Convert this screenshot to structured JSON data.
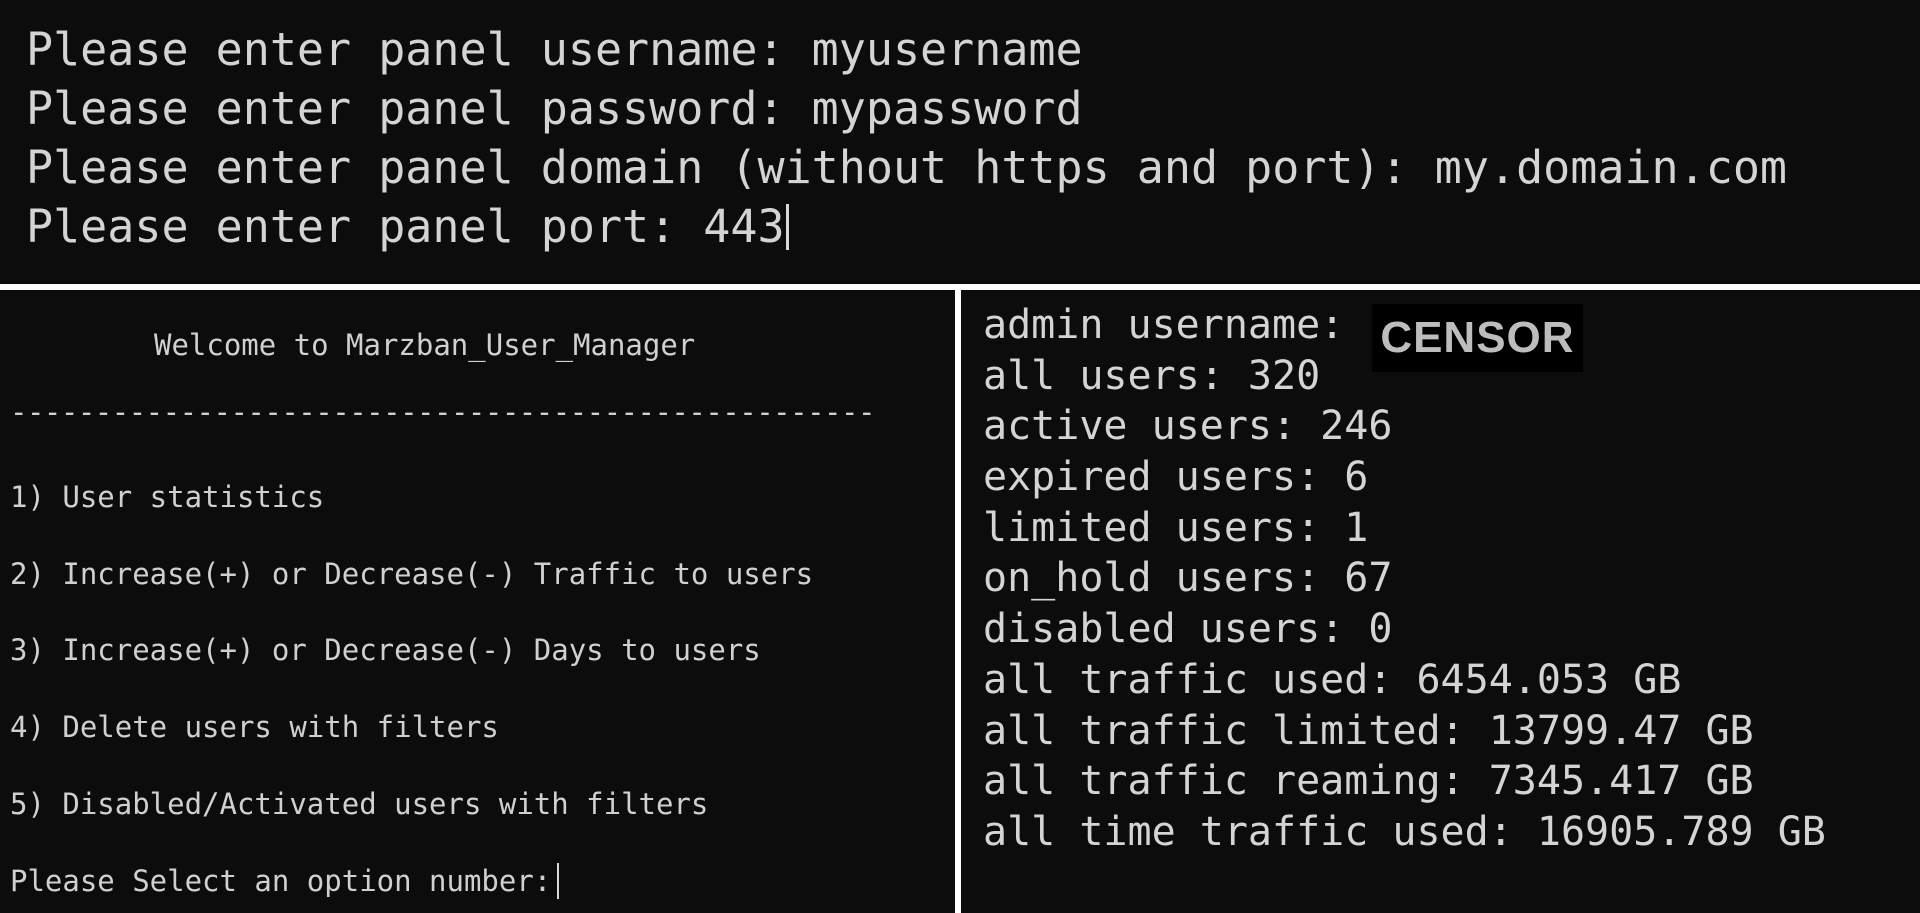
{
  "top_terminal": {
    "lines": [
      "Please enter panel username: myusername",
      "Please enter panel password: mypassword",
      "Please enter panel domain (without https and port): my.domain.com",
      "Please enter panel port: 443"
    ]
  },
  "left_terminal": {
    "welcome": "Welcome to Marzban_User_Manager",
    "divider": "---------------------------------------------------",
    "menu": [
      "1) User statistics",
      "2) Increase(+) or Decrease(-) Traffic to users",
      "3) Increase(+) or Decrease(-) Days to users",
      "4) Delete users with filters",
      "5) Disabled/Activated users with filters"
    ],
    "prompt": "Please Select an option number:"
  },
  "right_terminal": {
    "admin_label": "admin username: ",
    "admin_value": "CENSOR",
    "stats": [
      "all users: 320",
      "active users: 246",
      "expired users: 6",
      "limited users: 1",
      "on_hold users: 67",
      "disabled users: 0",
      "all traffic used: 6454.053 GB",
      "all traffic limited: 13799.47 GB",
      "all traffic reaming: 7345.417 GB",
      "all time traffic used: 16905.789 GB"
    ]
  }
}
